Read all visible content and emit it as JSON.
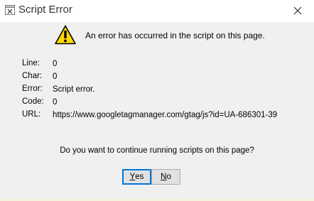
{
  "window": {
    "title": "Script Error",
    "close_icon": "close-icon",
    "app_icon": "script-error-app-icon"
  },
  "message": {
    "icon": "warning-icon",
    "text": "An error has occurred in the script on this page."
  },
  "details": {
    "line_label": "Line:",
    "line_value": "0",
    "char_label": "Char:",
    "char_value": "0",
    "error_label": "Error:",
    "error_value": "Script error.",
    "code_label": "Code:",
    "code_value": "0",
    "url_label": "URL:",
    "url_value": "https://www.googletagmanager.com/gtag/js?id=UA-686301-39"
  },
  "prompt": {
    "question": "Do you want to continue running scripts on this page?"
  },
  "buttons": {
    "yes_mnemonic": "Y",
    "yes_rest": "es",
    "no_mnemonic": "N",
    "no_rest": "o"
  },
  "colors": {
    "dialog_bg": "#f0f0f0",
    "titlebar_bg": "#ffffff",
    "button_bg": "#e1e1e1",
    "button_border": "#adadad",
    "focus_border": "#0078d7",
    "warning_yellow": "#ffd800"
  }
}
